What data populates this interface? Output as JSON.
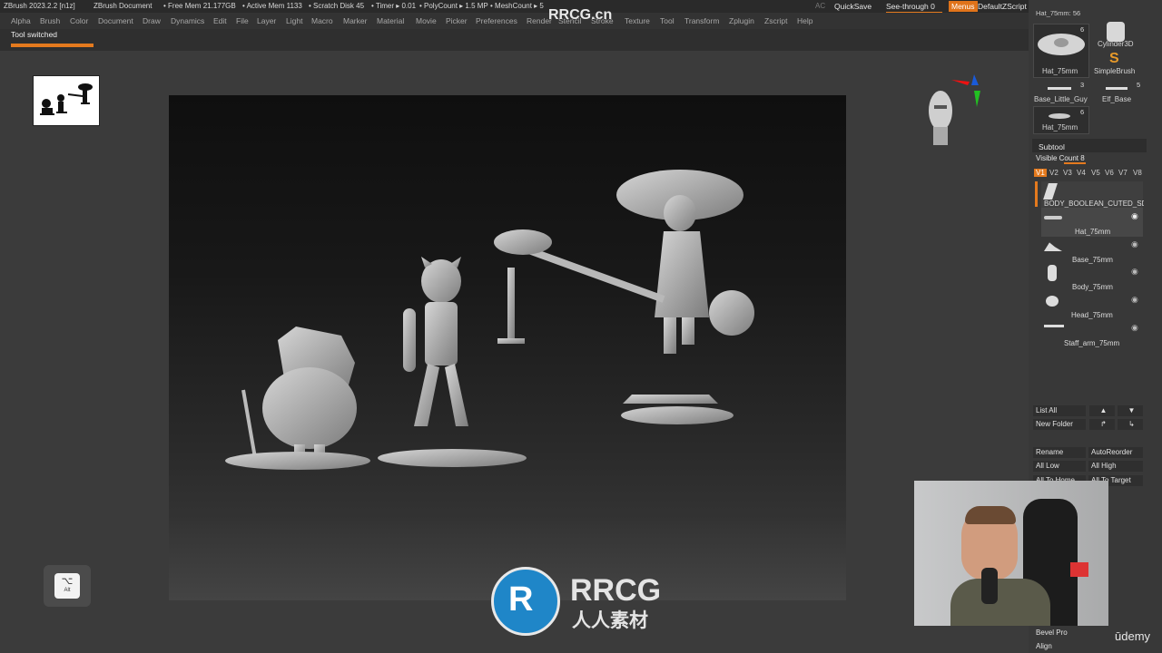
{
  "titlebar": {
    "app": "ZBrush 2023.2.2 [n1z]",
    "document": "ZBrush Document",
    "free_mem": "• Free Mem 21.177GB",
    "active_mem": "• Active Mem 1133",
    "scratch_disk": "• Scratch Disk 45",
    "timer": "• Timer ▸ 0.01",
    "polycount": "• PolyCount ▸ 1.5 MP",
    "meshcount": "• MeshCount ▸ 5",
    "ac": "AC",
    "quicksave": "QuickSave",
    "see_through": "See-through  0",
    "menus": "Menus",
    "default_script": "DefaultZScript"
  },
  "menubar": {
    "items": [
      "Alpha",
      "Brush",
      "Color",
      "Document",
      "Draw",
      "Dynamics",
      "Edit",
      "File",
      "Layer",
      "Light",
      "Macro",
      "Marker",
      "Material",
      "Movie",
      "Picker",
      "Preferences",
      "Render",
      "Stencil",
      "Stroke",
      "Texture",
      "Tool",
      "Transform",
      "Zplugin",
      "Zscript",
      "Help"
    ]
  },
  "notification": {
    "text": "Tool switched"
  },
  "watermark": {
    "top": "RRCG.cn",
    "logo_text": "RRCG",
    "logo_sub": "人人素材",
    "udemy": "ūdemy"
  },
  "right_panel": {
    "top_label": "Hat_75mm: 56",
    "tools": [
      {
        "name": "Hat_75mm",
        "count": "6"
      },
      {
        "name": "Cylinder3D",
        "count": ""
      },
      {
        "name": "SimpleBrush",
        "count": ""
      },
      {
        "name": "Base_Little_Guy",
        "count": "3"
      },
      {
        "name": "Elf_Base",
        "count": "5"
      },
      {
        "name": "Hat_75mm",
        "count": "6"
      }
    ],
    "subtool_title": "Subtool",
    "visible_count": "Visible Count 8",
    "version_tabs": [
      "V1",
      "V2",
      "V3",
      "V4",
      "V5",
      "V6",
      "V7",
      "V8"
    ],
    "subtools": [
      "BODY_BOOLEAN_CUTED_SDM",
      "Hat_75mm",
      "Base_75mm",
      "Body_75mm",
      "Head_75mm",
      "Staff_arm_75mm"
    ],
    "list_all": "List All",
    "new_folder": "New Folder",
    "rename": "Rename",
    "auto_reorder": "AutoReorder",
    "all_low": "All Low",
    "all_high": "All High",
    "all_to_home": "All To Home",
    "all_to_target": "All To Target",
    "bevel_pro": "Bevel Pro",
    "align": "Align"
  },
  "alt_key": {
    "symbol": "⌥",
    "label": "Alt"
  },
  "colors": {
    "accent": "#e47a1e",
    "menus_bg": "#e0731a",
    "canvas_top": "#0f0f0f"
  }
}
